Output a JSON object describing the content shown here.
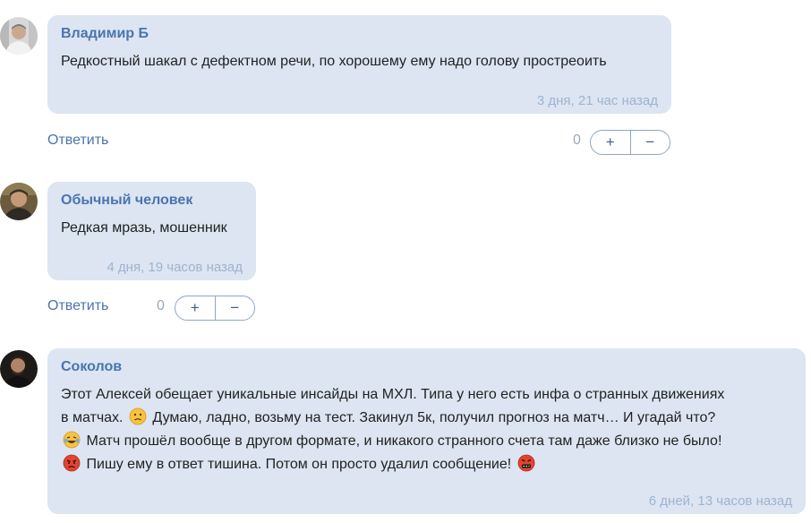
{
  "comments": [
    {
      "author": "Владимир Б",
      "text": "Редкостный шакал с дефектном речи, по хорошему ему надо голову простреоить",
      "time": "3 дня, 21 час назад",
      "reply_label": "Ответить",
      "votes": "0",
      "plus_label": "+",
      "minus_label": "−"
    },
    {
      "author": "Обычный человек",
      "text": "Редкая мразь, мошенник",
      "time": "4 дня, 19 часов назад",
      "reply_label": "Ответить",
      "votes": "0",
      "plus_label": "+",
      "minus_label": "−"
    },
    {
      "author": "Соколов",
      "text_parts": [
        "Этот Алексей обещает уникальные инсайды на МХЛ. Типа у него есть инфа о странных движениях",
        "в матчах.",
        "Думаю, ладно, возьму на тест. Закинул 5к, получил прогноз на матч… И угадай что?",
        "Матч прошёл вообще в другом формате, и никакого странного счета там даже близко не было!",
        "Пишу ему в ответ тишина. Потом он просто удалил сообщение!"
      ],
      "emojis": [
        "confused-face",
        "laughing-crying-face",
        "angry-face",
        "swearing-face"
      ],
      "time": "6 дней, 13 часов назад"
    }
  ],
  "colors": {
    "bubble": "#dce5f1",
    "author": "#4a74b0",
    "timestamp": "#9fb3cf",
    "link": "#4a74b0"
  }
}
